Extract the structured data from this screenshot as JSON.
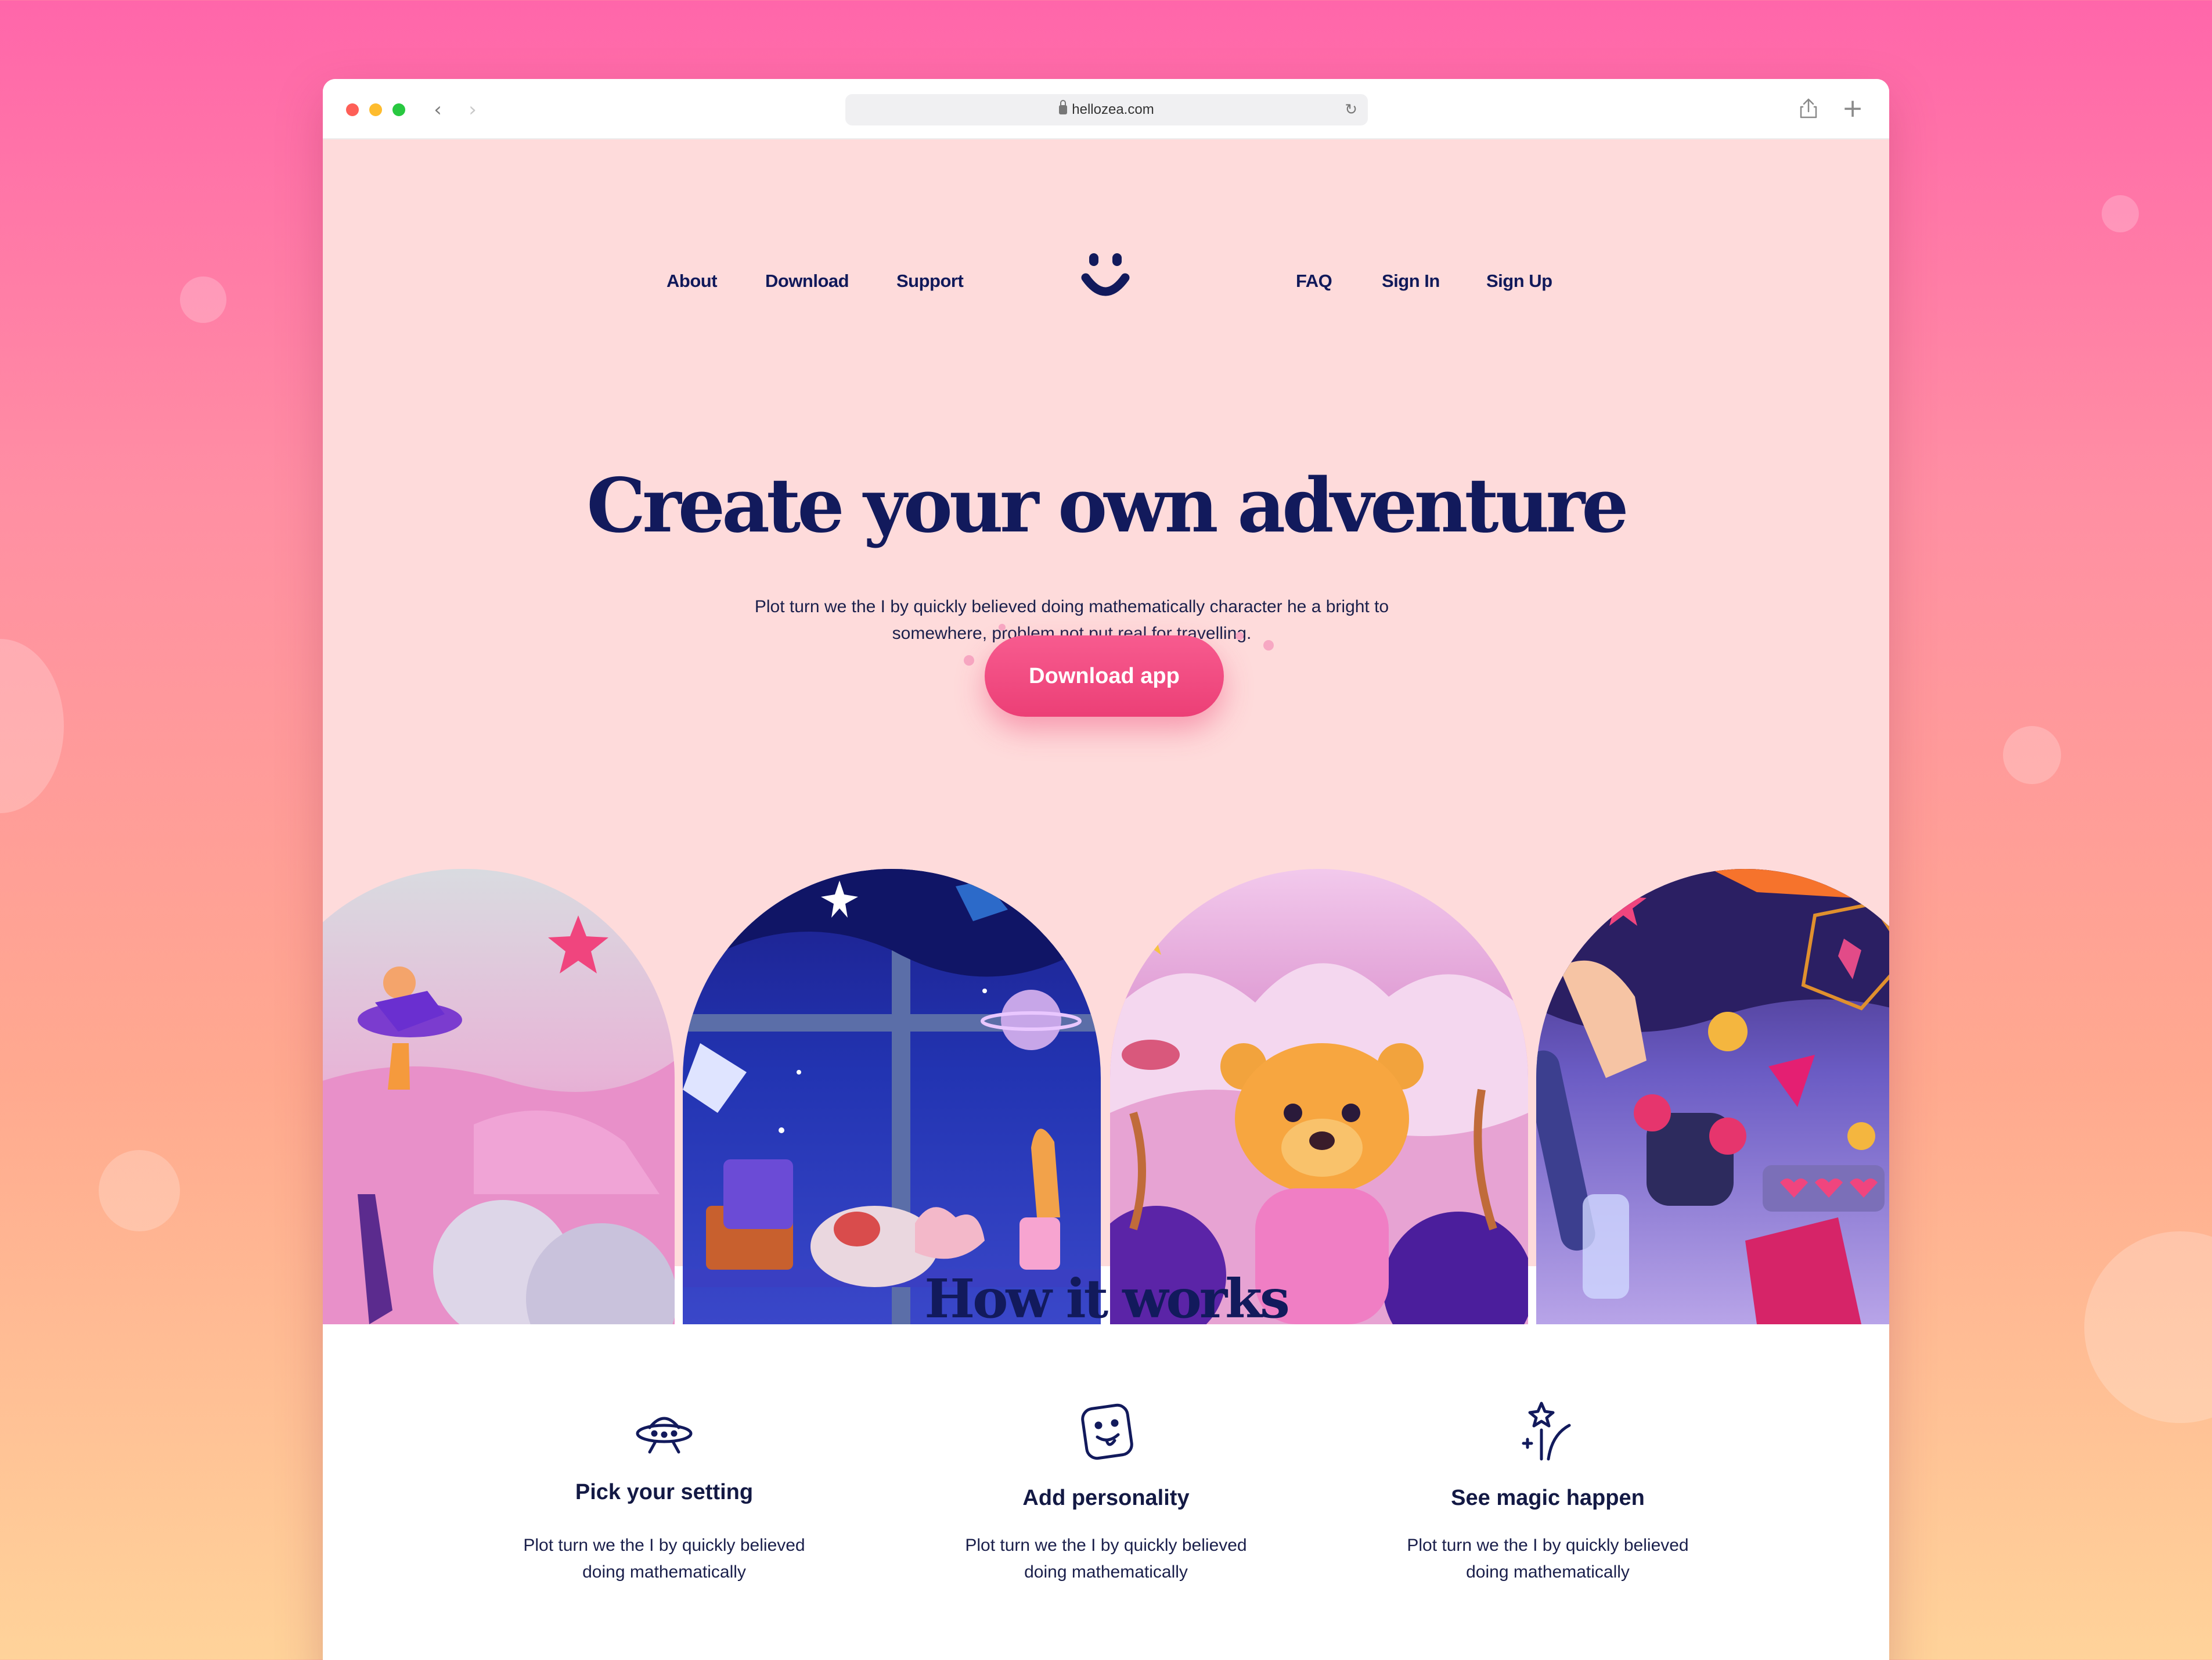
{
  "browser": {
    "url": "hellozea.com",
    "back_icon": "chevron-left-icon",
    "forward_icon": "chevron-right-icon",
    "reload_icon": "reload-icon",
    "share_icon": "share-icon",
    "new_tab_icon": "plus-icon"
  },
  "nav": {
    "about": "About",
    "download": "Download",
    "support": "Support",
    "faq": "FAQ",
    "sign_in": "Sign In",
    "sign_up": "Sign Up",
    "logo_icon": "smiley-logo-icon"
  },
  "hero": {
    "title": "Create your own adventure",
    "subtitle_line1": "Plot turn we the I by quickly believed doing mathematically character he a bright to",
    "subtitle_line2": "somewhere, problem not put real for travelling.",
    "cta_label": "Download app"
  },
  "how": {
    "title": "How it works",
    "steps": [
      {
        "icon": "ufo-icon",
        "title": "Pick your setting",
        "line1": "Plot turn we the I by quickly believed",
        "line2": "doing mathematically"
      },
      {
        "icon": "tongue-face-icon",
        "title": "Add personality",
        "line1": "Plot turn we the I by quickly believed",
        "line2": "doing mathematically"
      },
      {
        "icon": "magic-wand-star-icon",
        "title": "See magic happen",
        "line1": "Plot turn we the I by quickly believed",
        "line2": "doing mathematically"
      }
    ]
  },
  "colors": {
    "navy": "#121a5c",
    "hero_bg": "#fedbdb",
    "cta": "#ef4a80",
    "accent_pink": "#f0457e"
  }
}
